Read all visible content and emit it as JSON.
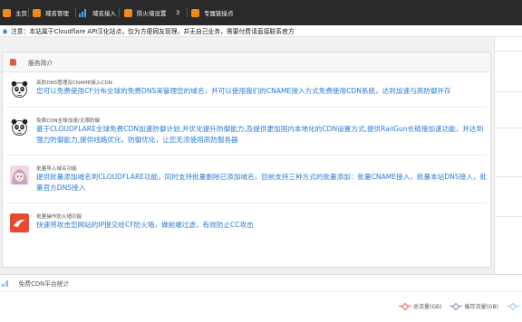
{
  "nav": {
    "items": [
      {
        "label": "主页",
        "icon": "home-icon"
      },
      {
        "label": "域名管理",
        "icon": "domain-icon"
      },
      {
        "label": "域名接入",
        "icon": "bar-chart-icon"
      },
      {
        "label": "防火墙设置",
        "icon": "firewall-icon"
      },
      {
        "label": "专属链接点",
        "icon": "mail-icon"
      }
    ],
    "count": "3"
  },
  "notice": {
    "text": "注意：本站属于Cloudflare API汉化站点，仅为方便网友管理，并无自己业务，需要付费请直接联系官方"
  },
  "panel": {
    "title": "服务简介",
    "services": [
      {
        "name": "高防DNS管理及CNAME接入CDN",
        "desc": "您可以免费使用CF分布全球的免费DNS来管理您的域名，并可以使用我们的CNAME接入方式免费使用CDN系统，达到加速与高防御并存"
      },
      {
        "name": "免费CDN全球加速/无限防御",
        "desc": "基于CLOUDFLARE全球免费CDN加速防御计划,并优化提升防御能力,及提供更加国内本地化的CDN设置方式,提供RailGun长链接加速功能，并达到强力防御能力,提供线路优化，防御优化，让您无须使用高防服务器"
      },
      {
        "name": "批量导入域名功能",
        "desc": "提供批量添加域名到CLOUDFLARE功能，同时支持批量删除已添加域名，目前支持三种方式的批量添加：批量CNAME接入，批量本站DNS接入，批量官方DNS接入"
      },
      {
        "name": "批量操作防火墙功能",
        "desc": "快速将攻击您网站的IP提交给CF防火墙，做前端过滤，有效防止CC攻击"
      }
    ]
  },
  "stats": {
    "title": "免费CDN平台统计",
    "legend": [
      {
        "label": "总流量(GB)",
        "color": "#e0614f"
      },
      {
        "label": "缓存流量(GB)",
        "color": "#7a8aa6"
      }
    ]
  }
}
